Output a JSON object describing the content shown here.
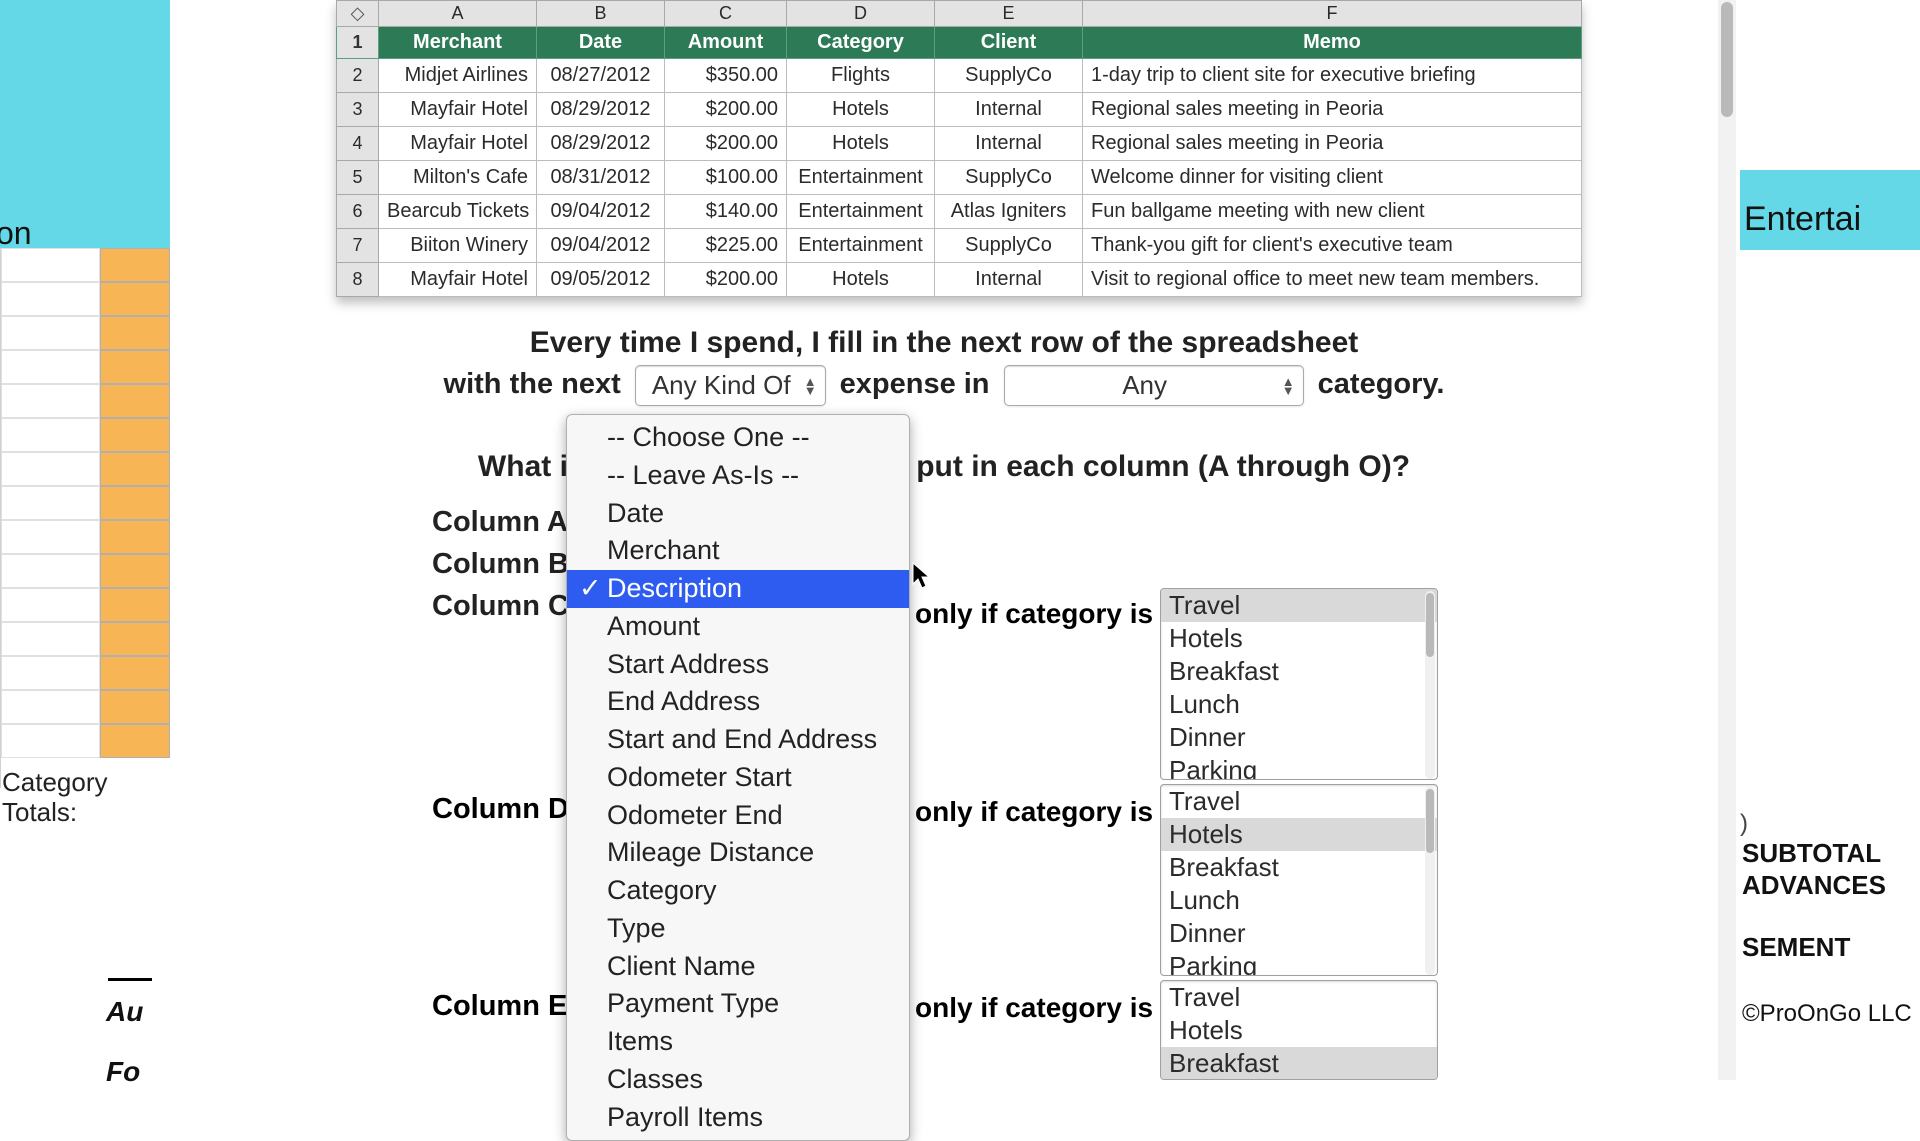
{
  "bg_left": {
    "tab": "on",
    "category_label": "Category",
    "totals_label": "Totals:",
    "au": "Au",
    "fo": "Fo"
  },
  "bg_right": {
    "header": "Entertai",
    "dollar": ")",
    "subtotal": "SUBTOTAL",
    "advances": "ADVANCES",
    "sement": "SEMENT",
    "copyright": "©ProOnGo LLC"
  },
  "sheet": {
    "col_letters": [
      "A",
      "B",
      "C",
      "D",
      "E",
      "F"
    ],
    "headers": [
      "Merchant",
      "Date",
      "Amount",
      "Category",
      "Client",
      "Memo"
    ],
    "rows": [
      {
        "n": "1"
      },
      {
        "n": "2",
        "merchant": "Midjet Airlines",
        "date": "08/27/2012",
        "amount": "$350.00",
        "category": "Flights",
        "client": "SupplyCo",
        "memo": "1-day trip to client site for executive briefing"
      },
      {
        "n": "3",
        "merchant": "Mayfair Hotel",
        "date": "08/29/2012",
        "amount": "$200.00",
        "category": "Hotels",
        "client": "Internal",
        "memo": "Regional sales meeting in Peoria"
      },
      {
        "n": "4",
        "merchant": "Mayfair Hotel",
        "date": "08/29/2012",
        "amount": "$200.00",
        "category": "Hotels",
        "client": "Internal",
        "memo": "Regional sales meeting in Peoria"
      },
      {
        "n": "5",
        "merchant": "Milton's Cafe",
        "date": "08/31/2012",
        "amount": "$100.00",
        "category": "Entertainment",
        "client": "SupplyCo",
        "memo": "Welcome dinner for visiting client"
      },
      {
        "n": "6",
        "merchant": "Bearcub Tickets",
        "date": "09/04/2012",
        "amount": "$140.00",
        "category": "Entertainment",
        "client": "Atlas Igniters",
        "memo": "Fun ballgame meeting with new client"
      },
      {
        "n": "7",
        "merchant": "Biiton Winery",
        "date": "09/04/2012",
        "amount": "$225.00",
        "category": "Entertainment",
        "client": "SupplyCo",
        "memo": "Thank-you gift for client's executive team"
      },
      {
        "n": "8",
        "merchant": "Mayfair Hotel",
        "date": "09/05/2012",
        "amount": "$200.00",
        "category": "Hotels",
        "client": "Internal",
        "memo": "Visit to regional office to meet new team members."
      }
    ]
  },
  "narrative": {
    "line1": "Every time I spend, I fill in the next row of the spreadsheet",
    "with_the_next": "with the next",
    "expense_in": "expense in",
    "category_suffix": "category.",
    "kind_select": "Any Kind Of",
    "category_select": "Any"
  },
  "question": "What information do you want put in each column (A through O)?",
  "column_labels": {
    "a": "Column A:",
    "b": "Column B:",
    "c": "Column C:",
    "d": "Column D:",
    "e": "Column E:"
  },
  "only_if": "only if category is",
  "dropdown_options": [
    "-- Choose One --",
    "-- Leave As-Is --",
    "Date",
    "Merchant",
    "Description",
    "Amount",
    "Start Address",
    "End Address",
    "Start and End Address",
    "Odometer Start",
    "Odometer End",
    "Mileage Distance",
    "Category",
    "Type",
    "Client Name",
    "Payment Type",
    "Items",
    "Classes",
    "Payroll Items"
  ],
  "catlist_c": [
    "Travel",
    "Hotels",
    "Breakfast",
    "Lunch",
    "Dinner",
    "Parking"
  ],
  "catlist_d": [
    "Travel",
    "Hotels",
    "Breakfast",
    "Lunch",
    "Dinner",
    "Parking"
  ],
  "catlist_e": [
    "Travel",
    "Hotels",
    "Breakfast"
  ]
}
